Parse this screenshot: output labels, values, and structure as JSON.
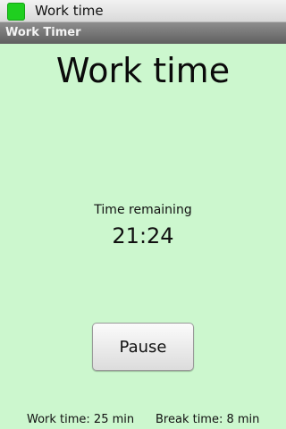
{
  "status_bar": {
    "title": "Work time",
    "icon": "green-square-icon",
    "icon_color": "#1fcf1f"
  },
  "title_bar": {
    "title": "Work Timer"
  },
  "main": {
    "heading": "Work time",
    "remaining_label": "Time remaining",
    "time_remaining": "21:24",
    "pause_label": "Pause"
  },
  "footer": {
    "work_time": "Work time: 25 min",
    "break_time": "Break time: 8 min"
  },
  "colors": {
    "background": "#ccf7ce",
    "title_bar": "#7a7a7a"
  }
}
